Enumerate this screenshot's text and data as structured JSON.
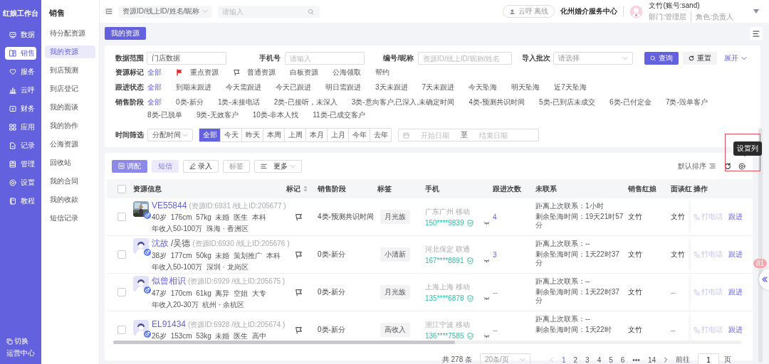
{
  "app": {
    "title": "红娘工作台",
    "nav": [
      {
        "label": "数据",
        "selected": false
      },
      {
        "label": "销售",
        "selected": true
      },
      {
        "label": "服务",
        "selected": false
      },
      {
        "label": "云呼",
        "selected": false
      },
      {
        "label": "财务",
        "selected": false
      },
      {
        "label": "应用",
        "selected": false
      },
      {
        "label": "记录",
        "selected": false
      },
      {
        "label": "管理",
        "selected": false
      },
      {
        "label": "设置",
        "selected": false
      },
      {
        "label": "教程",
        "selected": false
      }
    ],
    "switch": {
      "label": "切换",
      "target": "运营中心"
    }
  },
  "submenu": {
    "title": "销售",
    "items": [
      {
        "label": "待分配资源",
        "selected": false
      },
      {
        "label": "我的资源",
        "selected": true
      },
      {
        "label": "到店预测",
        "selected": false
      },
      {
        "label": "到店登记",
        "selected": false
      },
      {
        "label": "我的面谈",
        "selected": false
      },
      {
        "label": "我的协作",
        "selected": false
      },
      {
        "label": "公海资源",
        "selected": false
      },
      {
        "label": "回收站",
        "selected": false
      },
      {
        "label": "我的合同",
        "selected": false
      },
      {
        "label": "我的收款",
        "selected": false
      },
      {
        "label": "短信记录",
        "selected": false
      }
    ]
  },
  "topbar": {
    "search_type": "资源ID/线上ID/姓名/昵称",
    "search": {
      "placeholder": "请输入"
    },
    "call_status": "云呼 离线",
    "org": "化州婚介服务中心",
    "user": {
      "name": "文竹(账号:sand)",
      "dept": "部门:管理层",
      "role": "角色:负责人"
    }
  },
  "page_tab": {
    "label": "我的资源",
    "selected": true
  },
  "filters": {
    "fields": [
      {
        "label": "数据范围",
        "kind": "input",
        "value": "门店数据"
      },
      {
        "label": "手机号",
        "kind": "input",
        "placeholder": "请输入"
      },
      {
        "label": "编号/昵称",
        "kind": "input",
        "placeholder": "资源ID/线上ID/昵称/姓名"
      },
      {
        "label": "导入批次",
        "kind": "select",
        "placeholder": "请选择"
      }
    ],
    "query": "查询",
    "reset": "重置",
    "expand": "展开",
    "groups": [
      {
        "label": "资源标记",
        "options": [
          {
            "label": "全部",
            "selected": true,
            "kind": "plain"
          },
          {
            "label": "重点资源",
            "selected": false,
            "kind": "important"
          },
          {
            "label": "普通资源",
            "selected": false,
            "kind": "normal"
          },
          {
            "label": "白板资源",
            "selected": false,
            "kind": "plain"
          },
          {
            "label": "公海领取",
            "selected": false,
            "kind": "plain"
          },
          {
            "label": "帮约",
            "selected": false,
            "kind": "plain"
          }
        ]
      },
      {
        "label": "跟进状态",
        "options": [
          {
            "label": "全部",
            "selected": true,
            "kind": "plain"
          },
          {
            "label": "到期未跟进",
            "selected": false,
            "kind": "plain"
          },
          {
            "label": "今天需跟进",
            "selected": false,
            "kind": "plain"
          },
          {
            "label": "今天已跟进",
            "selected": false,
            "kind": "plain"
          },
          {
            "label": "明日需跟进",
            "selected": false,
            "kind": "plain"
          },
          {
            "label": "3天未跟进",
            "selected": false,
            "kind": "plain"
          },
          {
            "label": "7天未跟进",
            "selected": false,
            "kind": "plain"
          },
          {
            "label": "今天坠海",
            "selected": false,
            "kind": "plain"
          },
          {
            "label": "明天坠海",
            "selected": false,
            "kind": "plain"
          },
          {
            "label": "近7天坠海",
            "selected": false,
            "kind": "plain"
          }
        ]
      },
      {
        "label": "销售阶段",
        "options": [
          {
            "label": "全部",
            "selected": true,
            "kind": "plain"
          },
          {
            "label": "0类-新分",
            "selected": false,
            "kind": "plain"
          },
          {
            "label": "1类-未接电话",
            "selected": false,
            "kind": "plain"
          },
          {
            "label": "2类-已接听，未深入",
            "selected": false,
            "kind": "plain"
          },
          {
            "label": "3类-意向客户,已深入,未确定时间",
            "selected": false,
            "kind": "plain"
          },
          {
            "label": "4类-预测共识时间",
            "selected": false,
            "kind": "plain"
          },
          {
            "label": "5类-已到店未成交",
            "selected": false,
            "kind": "plain"
          },
          {
            "label": "6类-已付定金",
            "selected": false,
            "kind": "plain"
          },
          {
            "label": "7类-毁单客户",
            "selected": false,
            "kind": "plain"
          },
          {
            "label": "8类-已脱单",
            "selected": false,
            "kind": "plain"
          },
          {
            "label": "9类-无效客户",
            "selected": false,
            "kind": "plain"
          },
          {
            "label": "10类-非本人找",
            "selected": false,
            "kind": "plain"
          },
          {
            "label": "11类-已成交客户",
            "selected": false,
            "kind": "plain"
          }
        ]
      }
    ],
    "time": {
      "label": "时间筛选",
      "type": "分配时间",
      "ranges": [
        {
          "label": "全部",
          "selected": true
        },
        {
          "label": "今天",
          "selected": false
        },
        {
          "label": "昨天",
          "selected": false
        },
        {
          "label": "本周",
          "selected": false
        },
        {
          "label": "上周",
          "selected": false
        },
        {
          "label": "本月",
          "selected": false
        },
        {
          "label": "上月",
          "selected": false
        },
        {
          "label": "今年",
          "selected": false
        },
        {
          "label": "去年",
          "selected": false
        }
      ],
      "start_placeholder": "开始日期",
      "to": "至",
      "end_placeholder": "结束日期"
    }
  },
  "toolbar": {
    "buttons": [
      {
        "label": "调配",
        "kind": "primary",
        "disabled": true
      },
      {
        "label": "短信",
        "kind": "light",
        "disabled": true
      },
      {
        "label": "录入",
        "kind": "edit",
        "disabled": false
      },
      {
        "label": "标签",
        "kind": "plain",
        "disabled": true
      },
      {
        "label": "更多",
        "kind": "more",
        "disabled": false
      }
    ],
    "sort": "默认排序",
    "tooltip": "设置列"
  },
  "table": {
    "columns": [
      "资源信息",
      "标记",
      "销售阶段",
      "标签",
      "手机",
      "跟进次数",
      "未联系",
      "销售红娘",
      "面谈红",
      "操作"
    ],
    "all_checked": false,
    "rows": [
      {
        "checked": false,
        "name": "VE55844",
        "ids": "(资源ID:6931 /线上ID:205677 )",
        "details": "40岁  176cm  57kg  未婚  医生  本科",
        "income": "年收入50-100万  珠海 · 香洲区",
        "stage": "4类-预测共识时间",
        "tag": "月光族",
        "region": "广东广州 移动",
        "phone": "150****9839",
        "follow_count": "4",
        "last_contact": "距离上次联系：1小时",
        "remaining": "剩余坠海时间：19天21时57分",
        "sales": "文竹",
        "interview": "文竹",
        "actions": [
          {
            "label": "打电话",
            "disabled": true
          },
          {
            "label": "跟进",
            "disabled": false
          }
        ]
      },
      {
        "kind": "default",
        "checked": false,
        "name": "沈故",
        "alias": "/吴德",
        "ids": "(资源ID:6930 /线上ID:205676 )",
        "details": "38岁  177cm  50kg  未婚  策划推广  本科",
        "income": "年收入50-100万  深圳 · 龙岗区",
        "stage": "0类-新分",
        "tag": "小清新",
        "region": "河北保定 联通",
        "phone": "167****8891",
        "follow_count": "3",
        "last_contact": "距离上次联系：--",
        "remaining": "剩余坠海时间：1天22时37分",
        "sales": "文竹",
        "interview": "文竹",
        "actions": [
          {
            "label": "打电话",
            "disabled": true
          },
          {
            "label": "跟进",
            "disabled": false
          }
        ]
      },
      {
        "kind": "default",
        "checked": false,
        "name": "似曾相识",
        "ids": "(资源ID:6929 /线上ID:205675 )",
        "details": "47岁  170cm  61kg  离异  空姐  大专",
        "income": "年收入20-30万  杭州 · 余杭区",
        "stage": "0类-新分",
        "tag": "月光族",
        "region": "上海上海 移动",
        "phone": "135****6878",
        "follow_count": "--",
        "last_contact": "距离上次联系：--",
        "remaining": "剩余坠海时间：1天22时37分",
        "sales": "文竹",
        "interview": "--",
        "actions": [
          {
            "label": "打电话",
            "disabled": true
          },
          {
            "label": "跟进",
            "disabled": false
          }
        ]
      },
      {
        "kind": "default",
        "checked": false,
        "name": "EL91434",
        "ids": "(资源ID:6928 /线上ID:205674 )",
        "details": "26岁  153cm  53kg  未婚  医生  高中",
        "stage": "0类-新分",
        "tag": "高收入",
        "region": "浙江宁波 移动",
        "phone": "136****7585",
        "follow_count": "--",
        "last_contact": "距离上次联系：--",
        "remaining": "剩余坠海时间：1天22时",
        "sales": "文竹",
        "interview": "--",
        "actions": [
          {
            "label": "打电话",
            "disabled": true
          },
          {
            "label": "跟进",
            "disabled": false
          }
        ]
      }
    ]
  },
  "pagination": {
    "total": "共 278 条",
    "page_size": "20条/页",
    "pages": [
      {
        "label": "1",
        "selected": true
      },
      {
        "label": "2",
        "selected": false
      },
      {
        "label": "3",
        "selected": false
      },
      {
        "label": "4",
        "selected": false
      },
      {
        "label": "5",
        "selected": false
      },
      {
        "label": "6",
        "selected": false
      },
      {
        "label": "•••",
        "selected": false
      },
      {
        "label": "14",
        "selected": false
      }
    ],
    "goto": "前往",
    "goto_value": "1",
    "page_unit": "页"
  },
  "float_badge": "81"
}
